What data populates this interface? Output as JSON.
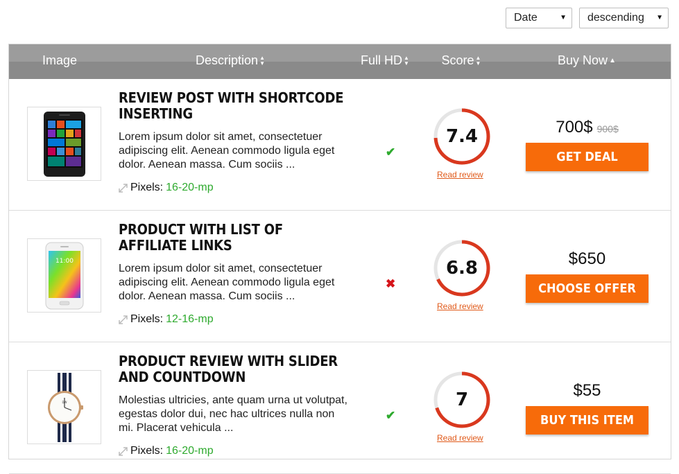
{
  "sort": {
    "field": "Date",
    "order": "descending"
  },
  "columns": {
    "image": "Image",
    "description": "Description",
    "fullhd": "Full HD",
    "score": "Score",
    "buynow": "Buy Now"
  },
  "products": [
    {
      "title": "Review post with shortcode inserting",
      "description": "Lorem ipsum dolor sit amet, consectetuer adipiscing elit. Aenean commodo ligula eget dolor. Aenean massa. Cum sociis ...",
      "pixels_label": "Pixels:",
      "pixels_value": "16-20-mp",
      "fullhd": true,
      "fullhd_icon": "checkmark-icon",
      "score": "7.4",
      "score_fraction": 0.74,
      "read_review": "Read review",
      "price": "700$",
      "old_price": "900$",
      "button": "Get Deal",
      "thumb_icon": "phone-icon"
    },
    {
      "title": "Product with list of affiliate links",
      "description": "Lorem ipsum dolor sit amet, consectetuer adipiscing elit. Aenean commodo ligula eget dolor. Aenean massa. Cum sociis ...",
      "pixels_label": "Pixels:",
      "pixels_value": "12-16-mp",
      "fullhd": false,
      "fullhd_icon": "cross-icon",
      "score": "6.8",
      "score_fraction": 0.68,
      "read_review": "Read review",
      "price": "$650",
      "old_price": "",
      "button": "Choose offer",
      "thumb_icon": "phone-icon"
    },
    {
      "title": "Product review with slider and countdown",
      "description": "Molestias ultricies, ante quam urna ut volutpat, egestas dolor dui, nec hac ultrices nulla non mi. Placerat vehicula ...",
      "pixels_label": "Pixels:",
      "pixels_value": "16-20-mp",
      "fullhd": true,
      "fullhd_icon": "checkmark-icon",
      "score": "7",
      "score_fraction": 0.7,
      "read_review": "Read review",
      "price": "$55",
      "old_price": "",
      "button": "Buy this item",
      "thumb_icon": "watch-icon"
    }
  ],
  "colors": {
    "accent": "#f76b0a",
    "header_bg": "#9c9c9c",
    "green": "#2eaa2e",
    "red": "#d6141a",
    "ring": "#d9381e"
  }
}
